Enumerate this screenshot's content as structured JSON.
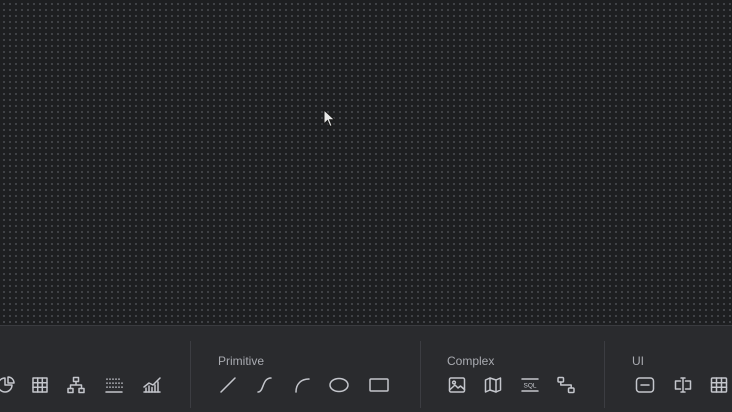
{
  "groups": {
    "primitive": {
      "label": "Primitive"
    },
    "complex": {
      "label": "Complex"
    },
    "ui": {
      "label": "UI"
    }
  },
  "tools": {
    "charts": [
      "pie-chart-icon",
      "heatmap-icon",
      "tree-diagram-icon",
      "histogram-icon",
      "area-chart-icon"
    ],
    "primitive": [
      "line-icon",
      "curve-icon",
      "arc-icon",
      "ellipse-icon",
      "rectangle-icon"
    ],
    "complex": [
      "image-icon",
      "map-icon",
      "sql-icon",
      "flow-connector-icon"
    ],
    "ui": [
      "button-icon",
      "text-input-icon",
      "table-icon"
    ]
  },
  "icon_glyphs": {
    "sql_text": "SQL"
  }
}
